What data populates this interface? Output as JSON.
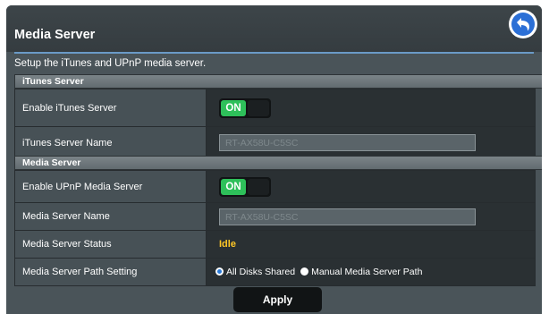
{
  "page": {
    "title": "Media Server",
    "description": "Setup the iTunes and UPnP media server."
  },
  "itunes_section": {
    "heading": "iTunes Server",
    "enable_label": "Enable iTunes Server",
    "enable_toggle": "ON",
    "name_label": "iTunes Server Name",
    "name_value": "RT-AX58U-C5SC"
  },
  "media_section": {
    "heading": "Media Server",
    "enable_label": "Enable UPnP Media Server",
    "enable_toggle": "ON",
    "name_label": "Media Server Name",
    "name_value": "RT-AX58U-C5SC",
    "status_label": "Media Server Status",
    "status_value": "Idle",
    "path_label": "Media Server Path Setting",
    "path_options": [
      "All Disks Shared",
      "Manual Media Server Path"
    ],
    "path_selected": "All Disks Shared"
  },
  "actions": {
    "apply_label": "Apply"
  },
  "icons": {
    "back": "back-arrow-icon"
  },
  "colors": {
    "toggle_on": "#2ec05a",
    "status": "#ffc726",
    "accent_line": "#6a9ac7",
    "back_icon": "#2b6fd6"
  }
}
